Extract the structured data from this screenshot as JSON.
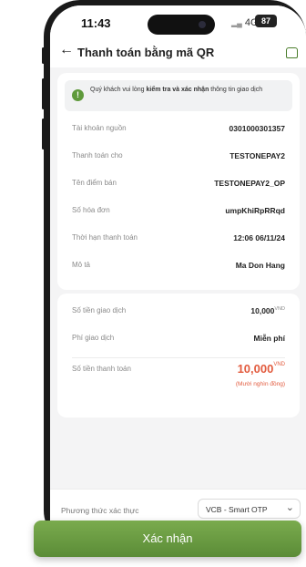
{
  "status_bar": {
    "time": "11:43",
    "network": "4G",
    "battery": "87"
  },
  "header": {
    "title": "Thanh toán bằng mã QR"
  },
  "notice": {
    "prefix": "Quý khách vui lòng ",
    "bold": "kiểm tra và xác nhận",
    "suffix": " thông tin giao dịch"
  },
  "details": [
    {
      "label": "Tài khoản nguồn",
      "value": "0301000301357"
    },
    {
      "label": "Thanh toán cho",
      "value": "TESTONEPAY2"
    },
    {
      "label": "Tên điểm bán",
      "value": "TESTONEPAY2_OP"
    },
    {
      "label": "Số hóa đơn",
      "value": "umpKhiRpRRqd"
    },
    {
      "label": "Thời hạn thanh toán",
      "value": "12:06 06/11/24"
    },
    {
      "label": "Mô tả",
      "value": "Ma Don Hang"
    }
  ],
  "amounts": {
    "transaction_label": "Số tiền giao dịch",
    "transaction_value": "10,000",
    "currency": "VND",
    "fee_label": "Phí giao dịch",
    "fee_value": "Miễn phí",
    "total_label": "Số tiền thanh toán",
    "total_value": "10,000",
    "total_words": "(Mười nghìn đồng)"
  },
  "auth": {
    "label": "Phương thức xác thực",
    "selected": "VCB - Smart OTP"
  },
  "confirm_button": {
    "label": "Xác nhận"
  },
  "colors": {
    "accent": "#5b8c37",
    "amount": "#e25b3e"
  },
  "icons": {
    "back": "arrow-left-icon",
    "home": "home-icon",
    "info": "info-icon",
    "dropdown": "chevron-down-icon"
  }
}
